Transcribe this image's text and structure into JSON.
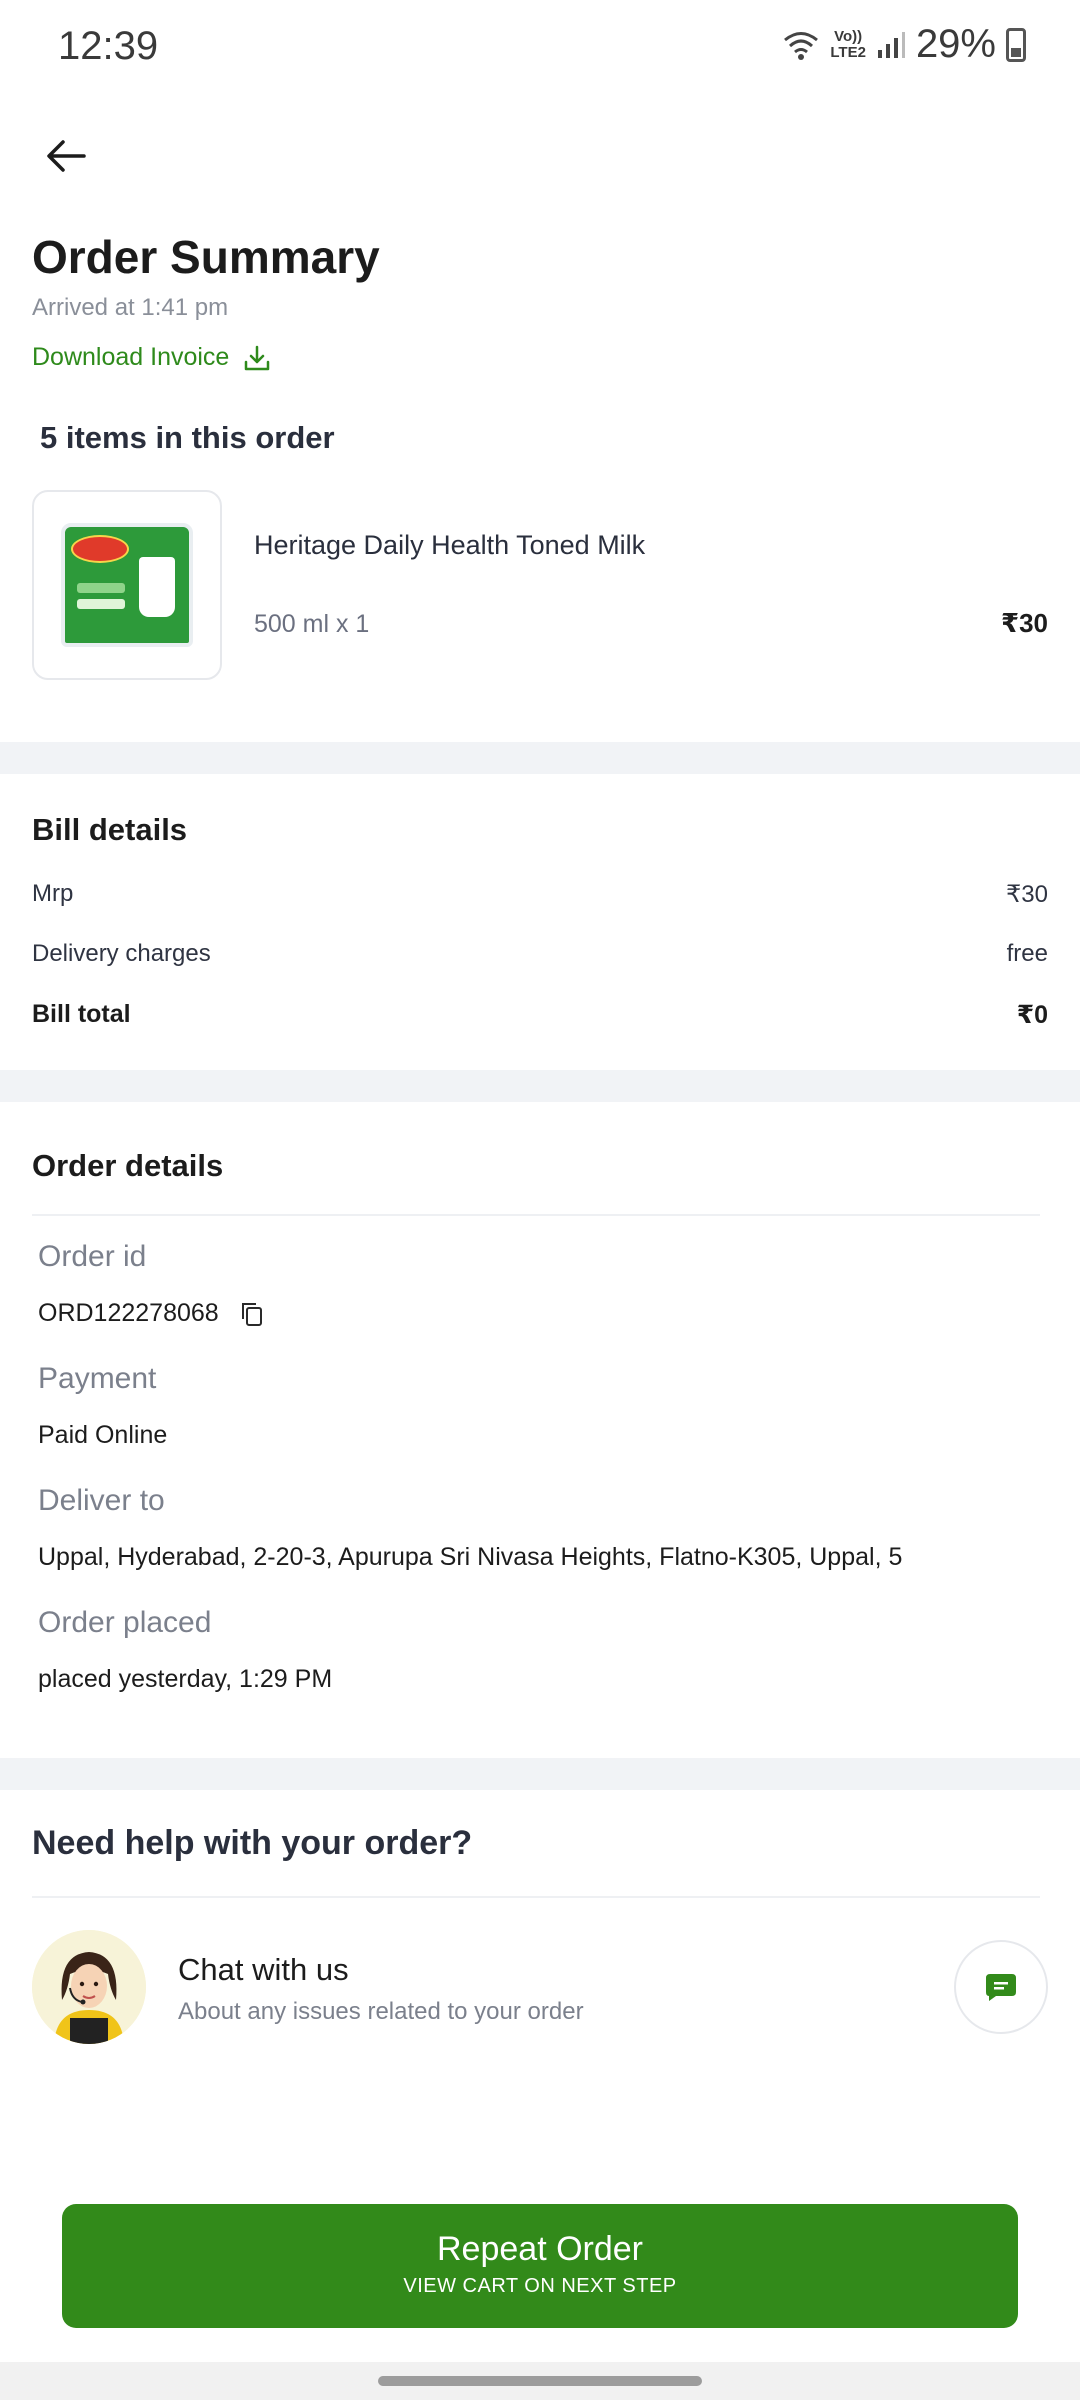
{
  "status_bar": {
    "time": "12:39",
    "network_top": "Vo))",
    "network_bottom": "LTE2",
    "battery_pct": "29%"
  },
  "header": {
    "title": "Order Summary",
    "arrived": "Arrived at 1:41 pm",
    "download_invoice": "Download Invoice"
  },
  "items": {
    "count_label": "5 items in this order",
    "list": [
      {
        "name": "Heritage Daily Health Toned Milk",
        "qty": "500 ml x 1",
        "price": "₹30"
      }
    ]
  },
  "bill": {
    "title": "Bill details",
    "rows": [
      {
        "label": "Mrp",
        "value": "₹30"
      },
      {
        "label": "Delivery charges",
        "value": "free"
      }
    ],
    "total_label": "Bill total",
    "total_value": "₹0"
  },
  "order_details": {
    "title": "Order details",
    "order_id_label": "Order id",
    "order_id": "ORD122278068",
    "payment_label": "Payment",
    "payment": "Paid Online",
    "deliver_label": "Deliver to",
    "deliver": "Uppal, Hyderabad, 2-20-3, Apurupa Sri Nivasa Heights, Flatno-K305, Uppal, 5",
    "placed_label": "Order placed",
    "placed": "placed yesterday, 1:29 PM"
  },
  "help": {
    "title": "Need help with your order?",
    "chat_title": "Chat with us",
    "chat_sub": "About any issues related to your order"
  },
  "cta": {
    "main": "Repeat Order",
    "sub": "VIEW CART ON NEXT STEP"
  },
  "colors": {
    "accent_green": "#328a1a",
    "link_green": "#2e8a1b",
    "section_gap": "#f1f3f6"
  }
}
